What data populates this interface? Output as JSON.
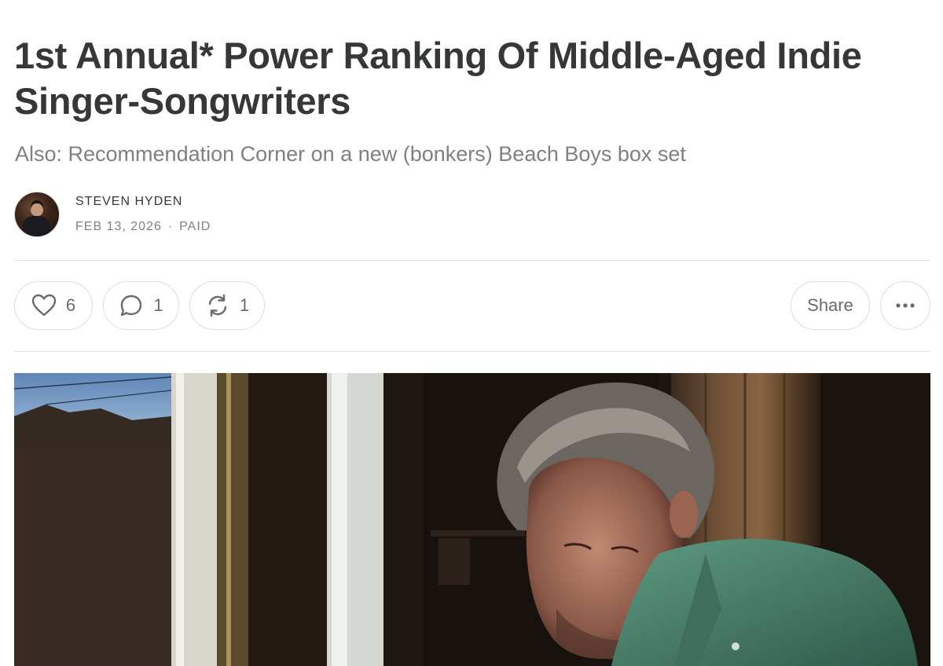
{
  "post": {
    "title": "1st Annual* Power Ranking Of Middle-Aged Indie Singer-Songwriters",
    "subtitle": "Also: Recommendation Corner on a new (bonkers) Beach Boys box set",
    "author": "STEVEN HYDEN",
    "date": "FEB 13, 2026",
    "separator": "·",
    "access": "PAID"
  },
  "actions": {
    "likes": "6",
    "comments": "1",
    "restacks": "1",
    "share_label": "Share"
  },
  "icons": {
    "like": "heart-icon",
    "comment": "comment-bubble-icon",
    "restack": "restack-arrows-icon",
    "more": "ellipsis-icon"
  },
  "colors": {
    "text": "#363737",
    "muted": "#808080",
    "border": "#dcdcdc"
  }
}
